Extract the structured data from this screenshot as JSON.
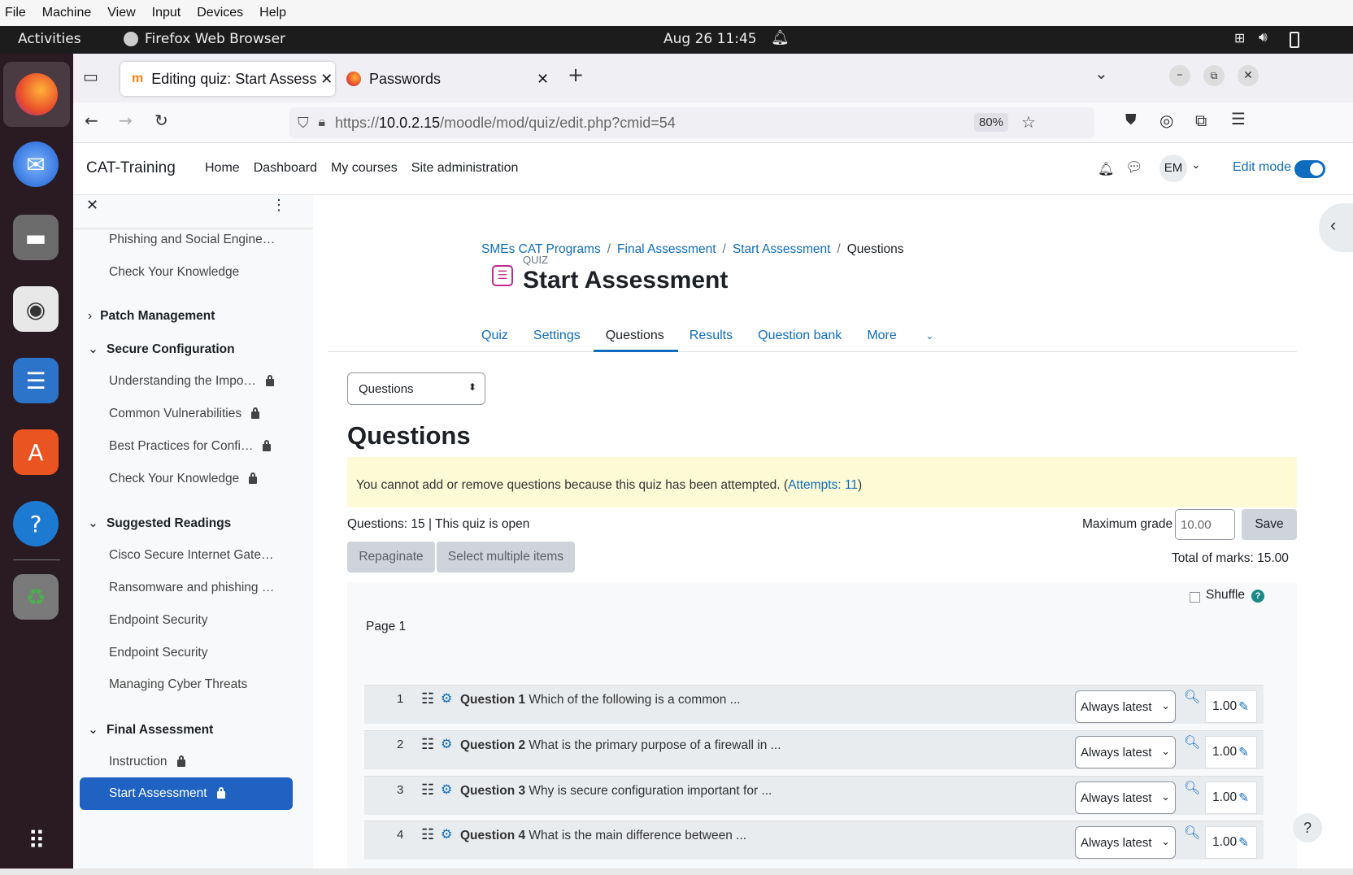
{
  "vm_menu": [
    "File",
    "Machine",
    "View",
    "Input",
    "Devices",
    "Help"
  ],
  "topbar": {
    "activities": "Activities",
    "app": "Firefox Web Browser",
    "clock": "Aug 26  11:45"
  },
  "tabs": [
    {
      "title": "Editing quiz: Start Assess"
    },
    {
      "title": "Passwords"
    }
  ],
  "url": {
    "prefix": "https://",
    "host": "10.0.2.15",
    "path": "/moodle/mod/quiz/edit.php?cmid=54",
    "zoom": "80%"
  },
  "site": {
    "brand": "CAT-Training",
    "nav": [
      "Home",
      "Dashboard",
      "My courses",
      "Site administration"
    ],
    "user_initials": "EM",
    "edit_mode": "Edit mode"
  },
  "drawer": {
    "items": [
      {
        "label": "Phishing and Social Engine…",
        "locked": false
      },
      {
        "label": "Check Your Knowledge",
        "locked": false
      }
    ],
    "sections": [
      {
        "title": "Patch Management",
        "expanded": false,
        "items": []
      },
      {
        "title": "Secure Configuration",
        "expanded": true,
        "items": [
          {
            "label": "Understanding the Impo…",
            "locked": true
          },
          {
            "label": "Common Vulnerabilities",
            "locked": true
          },
          {
            "label": "Best Practices for Confi…",
            "locked": true
          },
          {
            "label": "Check Your Knowledge",
            "locked": true
          }
        ]
      },
      {
        "title": "Suggested Readings",
        "expanded": true,
        "items": [
          {
            "label": "Cisco Secure Internet Gate…",
            "locked": false
          },
          {
            "label": "Ransomware and phishing …",
            "locked": false
          },
          {
            "label": "Endpoint Security",
            "locked": false
          },
          {
            "label": "Endpoint Security",
            "locked": false
          },
          {
            "label": "Managing Cyber Threats",
            "locked": false
          }
        ]
      },
      {
        "title": "Final Assessment",
        "expanded": true,
        "items": [
          {
            "label": "Instruction",
            "locked": true
          },
          {
            "label": "Start Assessment",
            "locked": true,
            "active": true
          }
        ]
      }
    ]
  },
  "breadcrumb": [
    "SMEs CAT Programs",
    "Final Assessment",
    "Start Assessment",
    "Questions"
  ],
  "header": {
    "kicker": "QUIZ",
    "title": "Start Assessment"
  },
  "secondary_nav": [
    "Quiz",
    "Settings",
    "Questions",
    "Results",
    "Question bank",
    "More"
  ],
  "secondary_nav_active": "Questions",
  "page_select": "Questions",
  "page_heading": "Questions",
  "notice": {
    "text": "You cannot add or remove questions because this quiz has been attempted. (",
    "link": "Attempts: 11",
    "close": ")"
  },
  "summary": "Questions: 15 | This quiz is open",
  "max_grade": {
    "label": "Maximum grade",
    "value": "10.00",
    "save": "Save"
  },
  "buttons": {
    "repaginate": "Repaginate",
    "select_multiple": "Select multiple items"
  },
  "total_marks": "Total of marks: 15.00",
  "shuffle": "Shuffle",
  "page_label": "Page 1",
  "questions": [
    {
      "num": "1",
      "name": "Question 1",
      "text": "Which of the following is a common ...",
      "version": "Always latest",
      "mark": "1.00"
    },
    {
      "num": "2",
      "name": "Question 2",
      "text": "What is the primary purpose of a firewall in ...",
      "version": "Always latest",
      "mark": "1.00"
    },
    {
      "num": "3",
      "name": "Question 3",
      "text": "Why is secure configuration important for ...",
      "version": "Always latest",
      "mark": "1.00"
    },
    {
      "num": "4",
      "name": "Question 4",
      "text": "What is the main difference between ...",
      "version": "Always latest",
      "mark": "1.00"
    }
  ],
  "help_button": "?",
  "colors": {
    "accent": "#0f6cbf",
    "notice_bg": "#fcfbd6",
    "active_item": "#1f62c1"
  }
}
